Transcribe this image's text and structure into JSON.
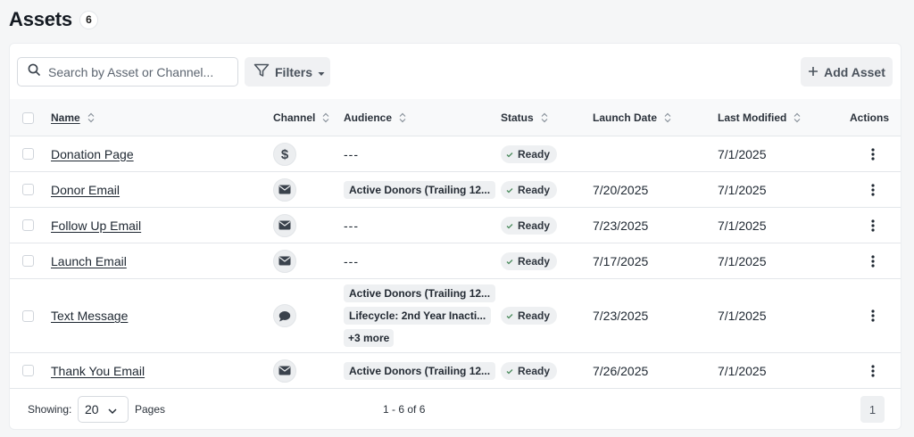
{
  "header": {
    "title": "Assets",
    "count": "6"
  },
  "toolbar": {
    "search_placeholder": "Search by Asset or Channel...",
    "filters_label": "Filters",
    "add_asset_label": "Add Asset"
  },
  "columns": {
    "name": "Name",
    "channel": "Channel",
    "audience": "Audience",
    "status": "Status",
    "launch_date": "Launch Date",
    "last_modified": "Last Modified",
    "actions": "Actions"
  },
  "rows": [
    {
      "name": "Donation Page",
      "channel_icon": "dollar-icon",
      "audience": [],
      "audience_empty": "---",
      "status": "Ready",
      "launch_date": "",
      "last_modified": "7/1/2025"
    },
    {
      "name": "Donor Email",
      "channel_icon": "mail-icon",
      "audience": [
        "Active Donors (Trailing 12..."
      ],
      "audience_empty": "",
      "status": "Ready",
      "launch_date": "7/20/2025",
      "last_modified": "7/1/2025"
    },
    {
      "name": "Follow Up Email",
      "channel_icon": "mail-icon",
      "audience": [],
      "audience_empty": "---",
      "status": "Ready",
      "launch_date": "7/23/2025",
      "last_modified": "7/1/2025"
    },
    {
      "name": "Launch Email",
      "channel_icon": "mail-icon",
      "audience": [],
      "audience_empty": "---",
      "status": "Ready",
      "launch_date": "7/17/2025",
      "last_modified": "7/1/2025"
    },
    {
      "name": "Text Message",
      "channel_icon": "chat-icon",
      "audience": [
        "Active Donors (Trailing 12...",
        "Lifecycle: 2nd Year Inacti...",
        "+3 more"
      ],
      "audience_empty": "",
      "status": "Ready",
      "launch_date": "7/23/2025",
      "last_modified": "7/1/2025"
    },
    {
      "name": "Thank You Email",
      "channel_icon": "mail-icon",
      "audience": [
        "Active Donors (Trailing 12..."
      ],
      "audience_empty": "",
      "status": "Ready",
      "launch_date": "7/26/2025",
      "last_modified": "7/1/2025"
    }
  ],
  "footer": {
    "showing_label": "Showing:",
    "page_size": "20",
    "pages_label": "Pages",
    "range_text": "1 - 6 of 6",
    "current_page": "1"
  },
  "colors": {
    "status_check": "#4a8a5c",
    "text": "#1e2731"
  }
}
